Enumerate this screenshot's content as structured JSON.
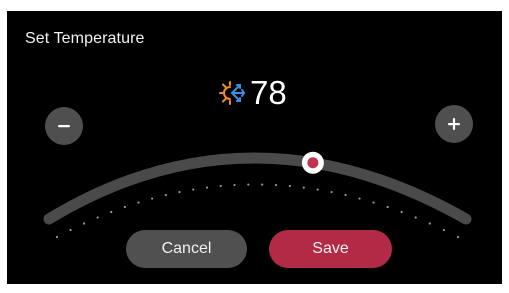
{
  "dialog": {
    "title": "Set Temperature"
  },
  "thermostat": {
    "mode_icon": "heat-cool-icon",
    "temperature": "78",
    "setpoint_fraction": 0.64,
    "colors": {
      "heat": "#f08a2a",
      "cool": "#3a8ee6",
      "accent": "#c0334f",
      "track": "#4a4a4a"
    }
  },
  "controls": {
    "decrease_icon": "minus-icon",
    "increase_icon": "plus-icon"
  },
  "actions": {
    "cancel_label": "Cancel",
    "save_label": "Save"
  }
}
